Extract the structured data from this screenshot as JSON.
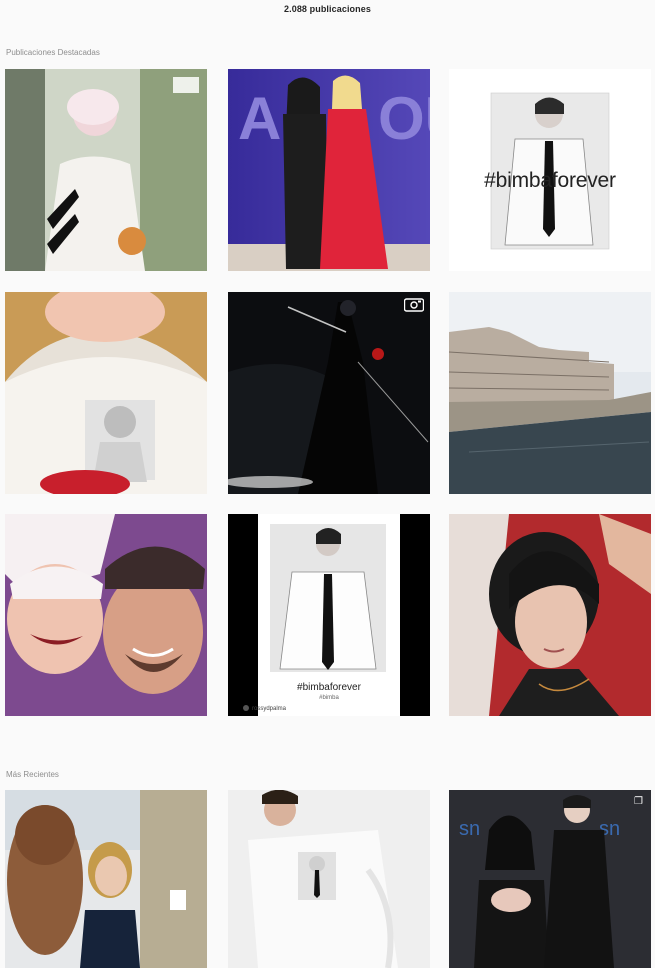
{
  "header": {
    "post_count": "2.088 publicaciones"
  },
  "sections": {
    "featured_label": "Publicaciones Destacadas",
    "recent_label": "Más Recientes"
  },
  "featured": {
    "tile_2_3_caption": "#bimbaforever",
    "tile_3_2_caption": "#bimbaforever",
    "tile_3_2_subcaption": "#bimba",
    "tile_3_2_credit": "rossydpalma"
  },
  "icons": {
    "video": "video-camera-icon",
    "gallery": "multiple-photos-icon"
  }
}
